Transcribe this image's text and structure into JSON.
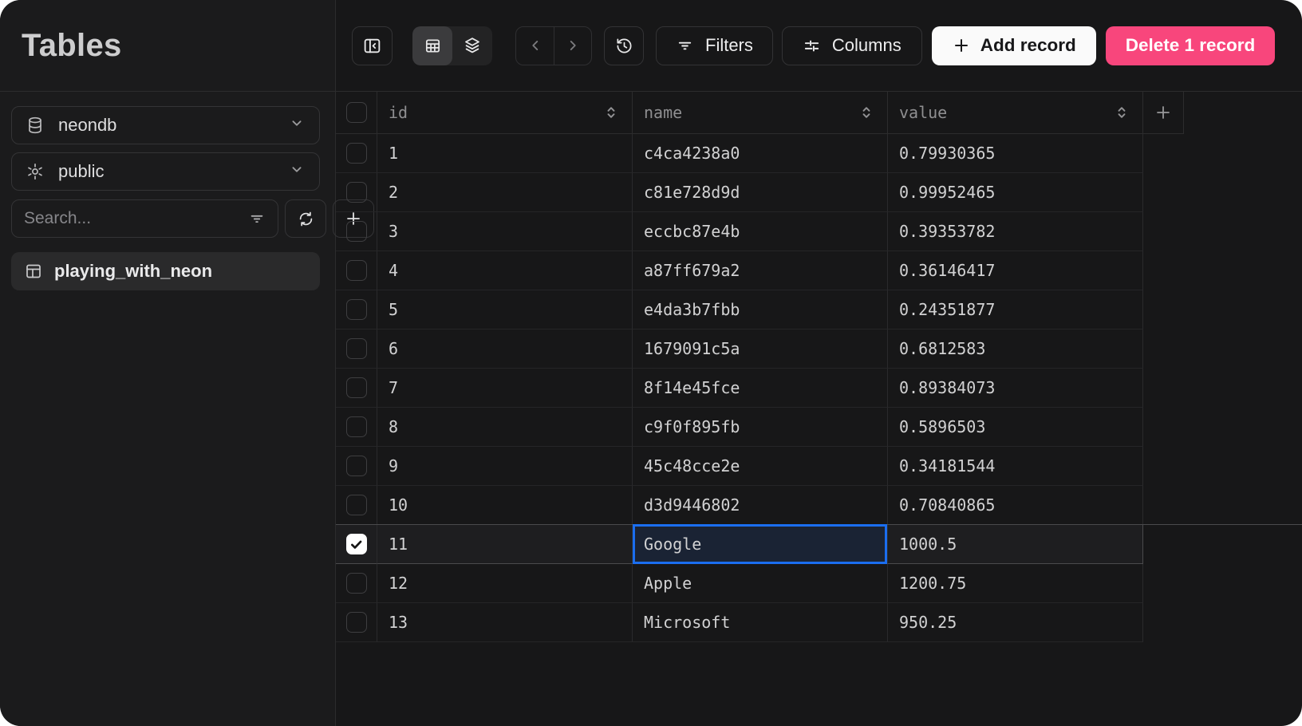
{
  "sidebar": {
    "title": "Tables",
    "database": {
      "value": "neondb"
    },
    "schema": {
      "value": "public"
    },
    "search_placeholder": "Search...",
    "tables": [
      {
        "label": "playing_with_neon",
        "active": true
      }
    ]
  },
  "toolbar": {
    "filters": "Filters",
    "columns": "Columns",
    "add_record": "Add record",
    "delete_record": "Delete 1 record"
  },
  "table": {
    "columns": [
      {
        "key": "id",
        "label": "id",
        "sortable": true
      },
      {
        "key": "name",
        "label": "name",
        "sortable": true
      },
      {
        "key": "value",
        "label": "value",
        "sortable": true
      }
    ],
    "rows": [
      {
        "id": "1",
        "name": "c4ca4238a0",
        "value": "0.79930365",
        "checked": false
      },
      {
        "id": "2",
        "name": "c81e728d9d",
        "value": "0.99952465",
        "checked": false
      },
      {
        "id": "3",
        "name": "eccbc87e4b",
        "value": "0.39353782",
        "checked": false
      },
      {
        "id": "4",
        "name": "a87ff679a2",
        "value": "0.36146417",
        "checked": false
      },
      {
        "id": "5",
        "name": "e4da3b7fbb",
        "value": "0.24351877",
        "checked": false
      },
      {
        "id": "6",
        "name": "1679091c5a",
        "value": "0.6812583",
        "checked": false
      },
      {
        "id": "7",
        "name": "8f14e45fce",
        "value": "0.89384073",
        "checked": false
      },
      {
        "id": "8",
        "name": "c9f0f895fb",
        "value": "0.5896503",
        "checked": false
      },
      {
        "id": "9",
        "name": "45c48cce2e",
        "value": "0.34181544",
        "checked": false
      },
      {
        "id": "10",
        "name": "d3d9446802",
        "value": "0.70840865",
        "checked": false
      },
      {
        "id": "11",
        "name": "Google",
        "value": "1000.5",
        "checked": true
      },
      {
        "id": "12",
        "name": "Apple",
        "value": "1200.75",
        "checked": false
      },
      {
        "id": "13",
        "name": "Microsoft",
        "value": "950.25",
        "checked": false
      }
    ],
    "selected_row_index": 10,
    "focused_cell": {
      "row_index": 10,
      "column": "name"
    },
    "selected_count": 1
  },
  "icons": {
    "database-icon": "cylinder",
    "schema-icon": "gear",
    "filter-lines-icon": "3 shrinking lines",
    "refresh-icon": "sync arrows",
    "plus-icon": "+",
    "table-icon": "table grid",
    "panel-collapse-icon": "panel with left chevron",
    "grid-view-icon": "spreadsheet",
    "layers-view-icon": "stacked layers",
    "chevron-left-icon": "<",
    "chevron-right-icon": ">",
    "history-icon": "clock with undo arrow",
    "sliders-icon": "adjuster sliders",
    "sort-icon": "up/down chevrons",
    "chevron-down-icon": "v",
    "check-icon": "checkmark"
  },
  "colors": {
    "accent_blue": "#1b6ef0",
    "danger_pink": "#f8467c",
    "sidebar_bg": "#1b1b1c",
    "main_bg": "#171718"
  }
}
